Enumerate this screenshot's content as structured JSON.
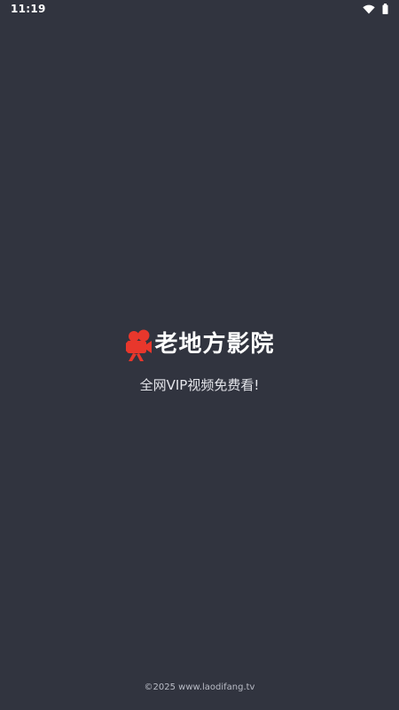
{
  "status_bar": {
    "time": "11:19",
    "icons": [
      "wifi-icon",
      "battery-icon"
    ]
  },
  "brand": {
    "logo_icon": "movie-camera-icon",
    "logo_color": "#e8372c",
    "title": "老地方影院"
  },
  "tagline": "全网VIP视频免费看!",
  "footer": {
    "copyright": "©2025 www.laodifang.tv"
  },
  "colors": {
    "background": "#31343f",
    "text": "#ffffff"
  }
}
